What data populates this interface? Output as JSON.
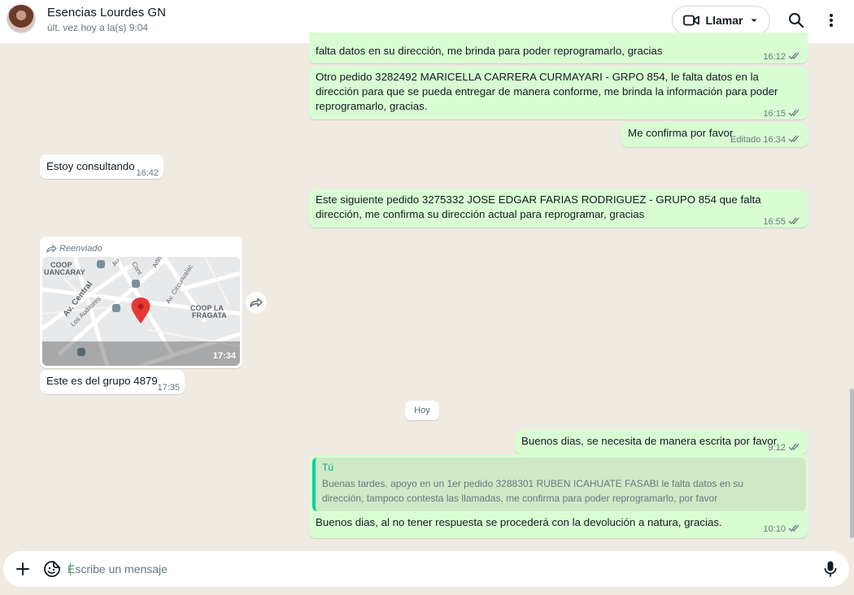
{
  "header": {
    "contact_name": "Esencias Lourdes GN",
    "last_seen": "últ. vez hoy a la(s) 9:04",
    "call_label": "Llamar"
  },
  "messages": [
    {
      "id": "m1",
      "direction": "outgoing",
      "text": "falta datos en su dirección, me brinda para poder reprogramarlo, gracias",
      "time": "16:12"
    },
    {
      "id": "m2",
      "direction": "outgoing",
      "text": "Otro pedido 3282492 MARICELLA CARRERA CURMAYARI - GRPO 854, le falta datos en la dirección para que se pueda entregar de manera conforme, me brinda la información para poder reprogramarlo, gracias.",
      "time": "16:15"
    },
    {
      "id": "m3",
      "direction": "outgoing",
      "text": "Me confirma por favor",
      "edited": "Editado",
      "time": "16:34"
    },
    {
      "id": "m4",
      "direction": "incoming",
      "text": "Estoy consultando",
      "time": "16:42"
    },
    {
      "id": "m5",
      "direction": "outgoing",
      "text": "Este siguiente pedido 3275332 JOSE EDGAR FARIAS RODRIGUEZ - GRUPO 854 que falta dirección, me confirma su dirección actual para reprogramar, gracias",
      "time": "16:55"
    },
    {
      "id": "m6",
      "direction": "incoming",
      "type": "location",
      "forwarded_label": "Reenviado",
      "time": "17:34",
      "map_labels": {
        "coop_left_1": "COOP",
        "coop_left_2": "UANCARAY",
        "street_1": "Av. Central",
        "street_2": "Los Auditores",
        "street_3": "Av. Circunvalac",
        "street_4": "Cont",
        "street_5": "Artis",
        "street_6": "Au",
        "coop_right_1": "COOP LA",
        "coop_right_2": "FRAGATA"
      }
    },
    {
      "id": "m7",
      "direction": "incoming",
      "text": "Este es del grupo 4879",
      "time": "17:35"
    },
    {
      "id": "m8",
      "direction": "outgoing",
      "text": "Buenos dias, se necesita de manera escrita por favor",
      "time": "9:12"
    },
    {
      "id": "m9",
      "direction": "outgoing",
      "quote_author": "Tú",
      "quote_text": "Buenas tardes, apoyo en un 1er pedido 3288301 RUBEN ICAHUATE FASABI le falta datos en su dirección, tampoco contesta las llamadas, me confirma para poder reprogramarlo, por favor",
      "text": "Buenos dias, al no tener respuesta se procederá con la devolución a natura, gracias.",
      "time": "10:10"
    }
  ],
  "date_separator": "Hoy",
  "composer": {
    "placeholder": "Escribe un mensaje"
  },
  "colors": {
    "outgoing_bubble": "#d9fdd3",
    "incoming_bubble": "#ffffff",
    "chat_background": "#efeae2",
    "read_ticks": "#53bdeb",
    "accent": "#25d366"
  },
  "icons": [
    "video-call-icon",
    "chevron-down-icon",
    "search-icon",
    "menu-dots-icon",
    "forward-icon",
    "map-pin-icon",
    "plus-icon",
    "sticker-icon",
    "microphone-icon",
    "double-check-icon"
  ]
}
